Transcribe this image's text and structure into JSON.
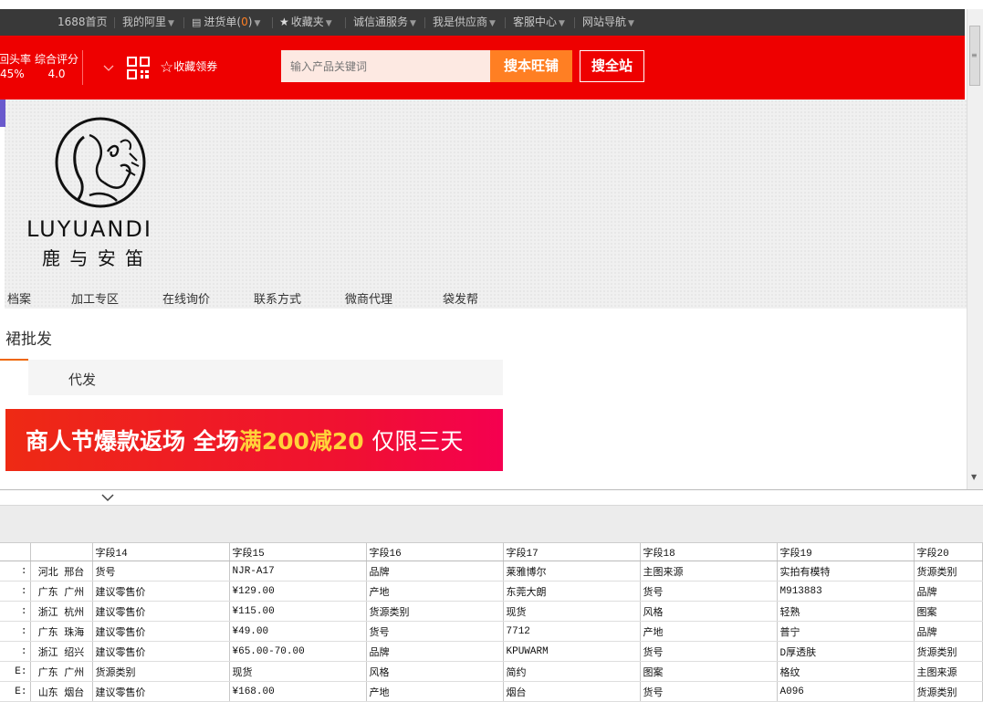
{
  "topnav": {
    "items": [
      {
        "label": "1688首页",
        "caret": false
      },
      {
        "label": "我的阿里",
        "caret": true
      },
      {
        "label": "进货单",
        "count": "0",
        "caret": true
      },
      {
        "label": "收藏夹",
        "caret": true
      },
      {
        "label": "诚信通服务",
        "caret": true
      },
      {
        "label": "我是供应商",
        "caret": true
      },
      {
        "label": "客服中心",
        "caret": true
      },
      {
        "label": "网站导航",
        "caret": true
      }
    ]
  },
  "header": {
    "stat1_label": "回头率",
    "stat1_value": "45%",
    "stat2_label": "综合评分",
    "stat2_value": "4.0",
    "coupon_label": "收藏领券",
    "search_placeholder": "输入产品关键词",
    "search_shop_label": "搜本旺铺",
    "search_all_label": "搜全站"
  },
  "shop": {
    "logo_en": "LUYUANDI",
    "logo_cn": "鹿 与 安 笛",
    "nav": [
      "档案",
      "加工专区",
      "在线询价",
      "联系方式",
      "微商代理",
      "袋发帮"
    ]
  },
  "content": {
    "category_title": "裙批发",
    "tab_label": "代发",
    "promo": {
      "part1": "商人节爆款返场 全场",
      "part2": "满200减20",
      "part3": "仅限三天"
    }
  },
  "grid": {
    "headers": [
      "",
      "",
      "字段14",
      "字段15",
      "字段16",
      "字段17",
      "字段18",
      "字段19",
      "字段20"
    ],
    "rows": [
      [
        ":",
        "河北 邢台",
        "货号",
        "NJR-A17",
        "品牌",
        "莱雅博尔",
        "主图来源",
        "实拍有模特",
        "货源类别"
      ],
      [
        ":",
        "广东 广州",
        "建议零售价",
        "¥129.00",
        "产地",
        "东莞大朗",
        "货号",
        "M913883",
        "品牌"
      ],
      [
        ":",
        "浙江 杭州",
        "建议零售价",
        "¥115.00",
        "货源类别",
        "现货",
        "风格",
        "轻熟",
        "图案"
      ],
      [
        ":",
        "广东 珠海",
        "建议零售价",
        "¥49.00",
        "货号",
        "7712",
        "产地",
        "普宁",
        "品牌"
      ],
      [
        ":",
        "浙江 绍兴",
        "建议零售价",
        "¥65.00-70.00",
        "品牌",
        "KPUWARM",
        "货号",
        "D厚透肤",
        "货源类别"
      ],
      [
        "E:",
        "广东 广州",
        "货源类别",
        "现货",
        "风格",
        "简约",
        "图案",
        "格纹",
        "主图来源"
      ],
      [
        "E:",
        "山东 烟台",
        "建议零售价",
        "¥168.00",
        "产地",
        "烟台",
        "货号",
        "A096",
        "货源类别"
      ]
    ]
  },
  "colors": {
    "topnav_bg": "#393939",
    "header_red": "#ee0000",
    "search_button": "#ff7f23",
    "promo_highlight": "#ffd23a"
  }
}
